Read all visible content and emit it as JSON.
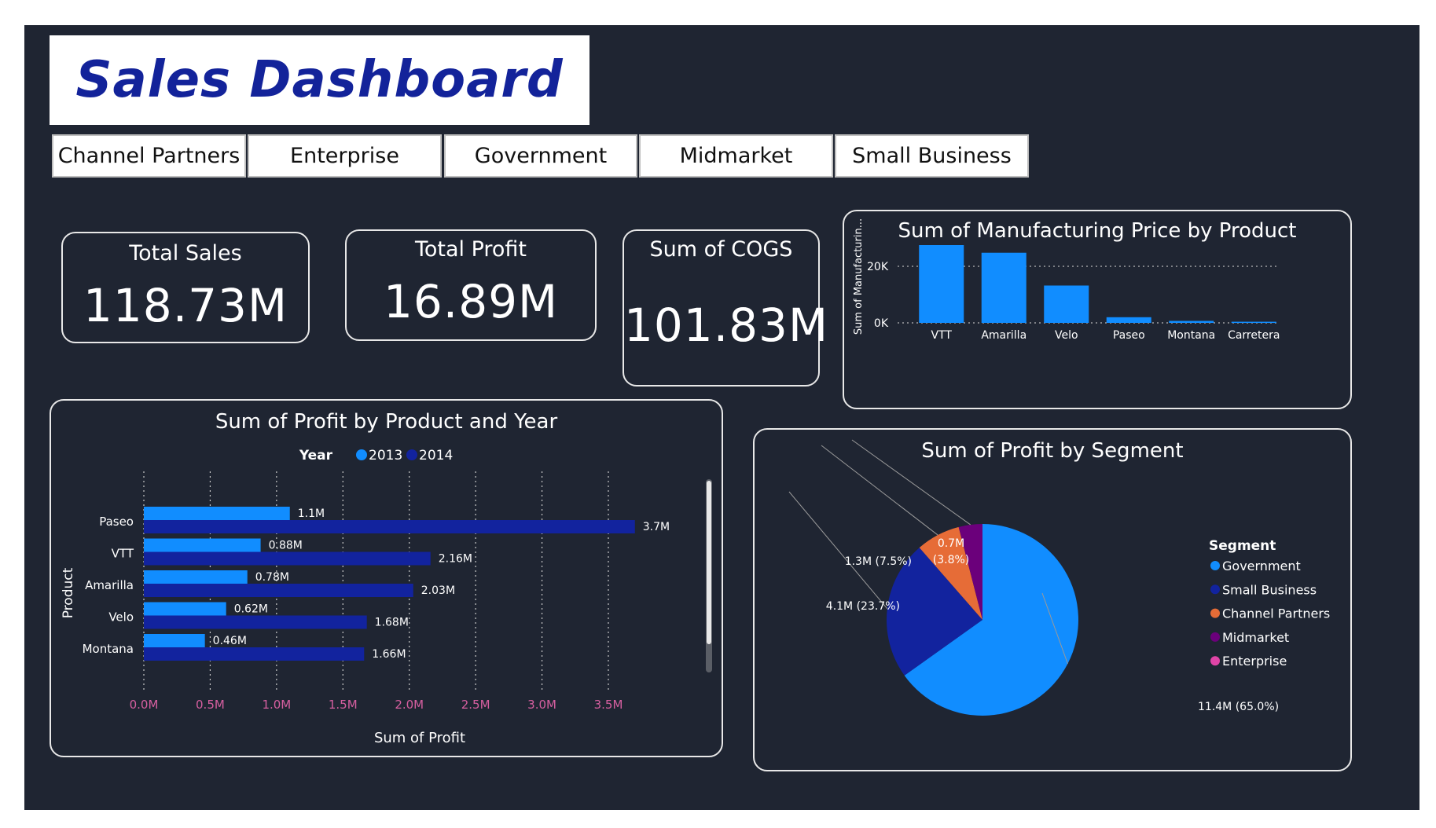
{
  "header": {
    "title": "Sales Dashboard"
  },
  "slicers": [
    "Channel Partners",
    "Enterprise",
    "Government",
    "Midmarket",
    "Small Business"
  ],
  "cards": {
    "total_sales": {
      "label": "Total Sales",
      "value": "118.73M"
    },
    "total_profit": {
      "label": "Total Profit",
      "value": "16.89M"
    },
    "cogs": {
      "label": "Sum of COGS",
      "value": "101.83M"
    }
  },
  "colors": {
    "background": "#1f2532",
    "accent_light": "#118dff",
    "accent_dark": "#12239e",
    "orange": "#e66c37",
    "purple": "#6b007b",
    "pink": "#e044a7",
    "tick_pink": "#d65fa0"
  },
  "chart_data": [
    {
      "type": "bar",
      "title": "Sum of Manufacturing Price by Product",
      "xlabel": "",
      "ylabel": "Sum of Manufacturin...",
      "categories": [
        "VTT",
        "Amarilla",
        "Velo",
        "Paseo",
        "Montana",
        "Carretera"
      ],
      "values": [
        27500,
        24800,
        13200,
        2000,
        700,
        400
      ],
      "ylim": [
        0,
        30000
      ],
      "yticks": [
        "0K",
        "20K"
      ],
      "ytick_values": [
        0,
        20000
      ],
      "grid": true,
      "color": "#118dff"
    },
    {
      "type": "bar",
      "orientation": "horizontal",
      "title": "Sum of Profit by Product and Year",
      "xlabel": "Sum of Profit",
      "ylabel": "Product",
      "legend_title": "Year",
      "legend_position": "top",
      "categories": [
        "Paseo",
        "VTT",
        "Amarilla",
        "Velo",
        "Montana"
      ],
      "series": [
        {
          "name": "2013",
          "color": "#118dff",
          "values": [
            1.1,
            0.88,
            0.78,
            0.62,
            0.46
          ],
          "labels": [
            "1.1M",
            "0.88M",
            "0.78M",
            "0.62M",
            "0.46M"
          ]
        },
        {
          "name": "2014",
          "color": "#12239e",
          "values": [
            3.7,
            2.16,
            2.03,
            1.68,
            1.66
          ],
          "labels": [
            "3.7M",
            "2.16M",
            "2.03M",
            "1.68M",
            "1.66M"
          ]
        }
      ],
      "xlim": [
        0,
        3.5
      ],
      "xticks": [
        "0.0M",
        "0.5M",
        "1.0M",
        "1.5M",
        "2.0M",
        "2.5M",
        "3.0M",
        "3.5M"
      ],
      "xtick_values": [
        0,
        0.5,
        1.0,
        1.5,
        2.0,
        2.5,
        3.0,
        3.5
      ],
      "grid": true
    },
    {
      "type": "pie",
      "title": "Sum of Profit by Segment",
      "legend_title": "Segment",
      "legend_position": "right",
      "slices": [
        {
          "name": "Government",
          "value": 11.4,
          "percent": 65.0,
          "label": "11.4M (65.0%)",
          "color": "#118dff"
        },
        {
          "name": "Small Business",
          "value": 4.1,
          "percent": 23.7,
          "label": "4.1M (23.7%)",
          "color": "#12239e"
        },
        {
          "name": "Channel Partners",
          "value": 1.3,
          "percent": 7.5,
          "label": "1.3M (7.5%)",
          "color": "#e66c37"
        },
        {
          "name": "Midmarket",
          "value": 0.7,
          "percent": 3.8,
          "label": "0.7M\n(3.8%)",
          "color": "#6b007b"
        },
        {
          "name": "Enterprise",
          "value": 0.0,
          "percent": 0.0,
          "label": "",
          "color": "#e044a7"
        }
      ]
    }
  ]
}
